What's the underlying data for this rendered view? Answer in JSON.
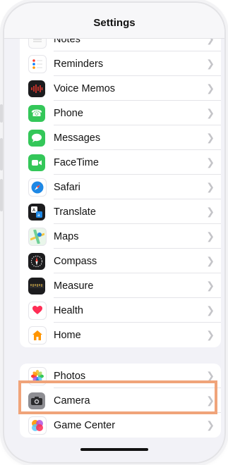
{
  "nav": {
    "title": "Settings"
  },
  "group1": [
    {
      "label": "Notes",
      "icon": "notes-icon",
      "color": "#fbfbfb"
    },
    {
      "label": "Reminders",
      "icon": "reminders-icon",
      "color": "#ffffff"
    },
    {
      "label": "Voice Memos",
      "icon": "waveform-icon",
      "color": "#1c1c1e"
    },
    {
      "label": "Phone",
      "icon": "phone-icon",
      "color": "#34c759"
    },
    {
      "label": "Messages",
      "icon": "message-bubble-icon",
      "color": "#34c759"
    },
    {
      "label": "FaceTime",
      "icon": "video-camera-icon",
      "color": "#34c759"
    },
    {
      "label": "Safari",
      "icon": "compass-needle-icon",
      "color": "#1e88e5"
    },
    {
      "label": "Translate",
      "icon": "translate-icon",
      "color": "#1c1c1e"
    },
    {
      "label": "Maps",
      "icon": "map-icon",
      "color": "#6fcf97"
    },
    {
      "label": "Compass",
      "icon": "compass-icon",
      "color": "#1c1c1e"
    },
    {
      "label": "Measure",
      "icon": "ruler-icon",
      "color": "#1c1c1e"
    },
    {
      "label": "Health",
      "icon": "heart-icon",
      "color": "#ffffff"
    },
    {
      "label": "Home",
      "icon": "house-icon",
      "color": "#ffffff"
    }
  ],
  "group2": [
    {
      "label": "Photos",
      "icon": "photos-flower-icon",
      "color": "#ffffff"
    },
    {
      "label": "Camera",
      "icon": "camera-icon",
      "color": "#8e8e93"
    },
    {
      "label": "Game Center",
      "icon": "game-center-icon",
      "color": "#ffffff"
    }
  ],
  "highlight_color": "#f0a47a"
}
